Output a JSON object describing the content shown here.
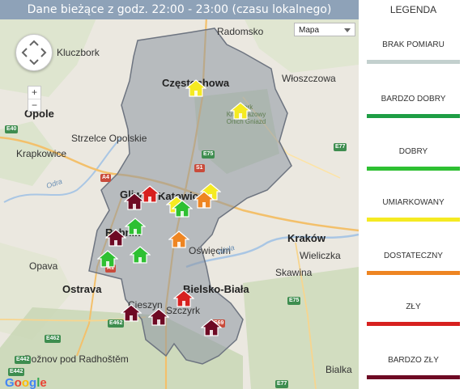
{
  "header": {
    "title": "Dane bieżące z godz. 22:00 - 23:00 (czasu lokalnego)"
  },
  "map_controls": {
    "map_type": "Mapa",
    "zoom_in": "+",
    "zoom_out": "−"
  },
  "google_logo": {
    "letters": [
      "G",
      "o",
      "o",
      "g",
      "l",
      "e"
    ],
    "colors": [
      "#4285f4",
      "#ea4335",
      "#fbbc05",
      "#4285f4",
      "#34a853",
      "#ea4335"
    ]
  },
  "places": [
    {
      "name": "Radomsko",
      "cls": "city"
    },
    {
      "name": "Kluczbork",
      "cls": "city"
    },
    {
      "name": "Częstochowa",
      "cls": "big"
    },
    {
      "name": "Włoszczowa",
      "cls": "city"
    },
    {
      "name": "Opole",
      "cls": "big"
    },
    {
      "name": "Strzelce Opolskie",
      "cls": "city"
    },
    {
      "name": "Krapkowice",
      "cls": "city"
    },
    {
      "name": "Park Krajobrazowy Orlich Gniazd",
      "cls": "park"
    },
    {
      "name": "Gliwice",
      "cls": "big"
    },
    {
      "name": "Katowice",
      "cls": "big"
    },
    {
      "name": "Rybnik",
      "cls": "big"
    },
    {
      "name": "Kraków",
      "cls": "big"
    },
    {
      "name": "Oświęcim",
      "cls": "city"
    },
    {
      "name": "Opava",
      "cls": "city"
    },
    {
      "name": "Ostrava",
      "cls": "big"
    },
    {
      "name": "Bielsko-Biała",
      "cls": "big"
    },
    {
      "name": "Cieszyn",
      "cls": "city"
    },
    {
      "name": "Szczyrk",
      "cls": "city"
    },
    {
      "name": "Wieliczka",
      "cls": "city"
    },
    {
      "name": "Skawina",
      "cls": "city"
    },
    {
      "name": "Rožnov pod Radhoštěm",
      "cls": "city"
    },
    {
      "name": "Bialka",
      "cls": "city"
    },
    {
      "name": "Wisła",
      "cls": "river"
    },
    {
      "name": "Odra",
      "cls": "river"
    }
  ],
  "roads": [
    "E40",
    "E75",
    "S1",
    "A4",
    "A1",
    "E462",
    "E462",
    "S69",
    "E77",
    "E75",
    "E442",
    "E442",
    "E77"
  ],
  "stations": [
    {
      "level": "umiarkowany"
    },
    {
      "level": "umiarkowany"
    },
    {
      "level": "bardzo_zly"
    },
    {
      "level": "zly"
    },
    {
      "level": "umiarkowany"
    },
    {
      "level": "umiarkowany"
    },
    {
      "level": "dobry"
    },
    {
      "level": "dostateczny"
    },
    {
      "level": "bardzo_zly"
    },
    {
      "level": "dobry"
    },
    {
      "level": "dostateczny"
    },
    {
      "level": "dobry"
    },
    {
      "level": "dobry"
    },
    {
      "level": "bardzo_zly"
    },
    {
      "level": "bardzo_zly"
    },
    {
      "level": "zly"
    },
    {
      "level": "bardzo_zly"
    }
  ],
  "legend": {
    "title": "LEGENDA",
    "items": [
      {
        "key": "brak",
        "label": "BRAK POMIARU",
        "color": "#c3d0ce"
      },
      {
        "key": "bardzo_dobry",
        "label": "BARDZO DOBRY",
        "color": "#1e9e45"
      },
      {
        "key": "dobry",
        "label": "DOBRY",
        "color": "#2ec032"
      },
      {
        "key": "umiarkowany",
        "label": "UMIARKOWANY",
        "color": "#f5ea22"
      },
      {
        "key": "dostateczny",
        "label": "DOSTATECZNY",
        "color": "#ee8522"
      },
      {
        "key": "zly",
        "label": "ZŁY",
        "color": "#d7201f"
      },
      {
        "key": "bardzo_zly",
        "label": "BARDZO ZŁY",
        "color": "#6e0a24"
      }
    ]
  }
}
